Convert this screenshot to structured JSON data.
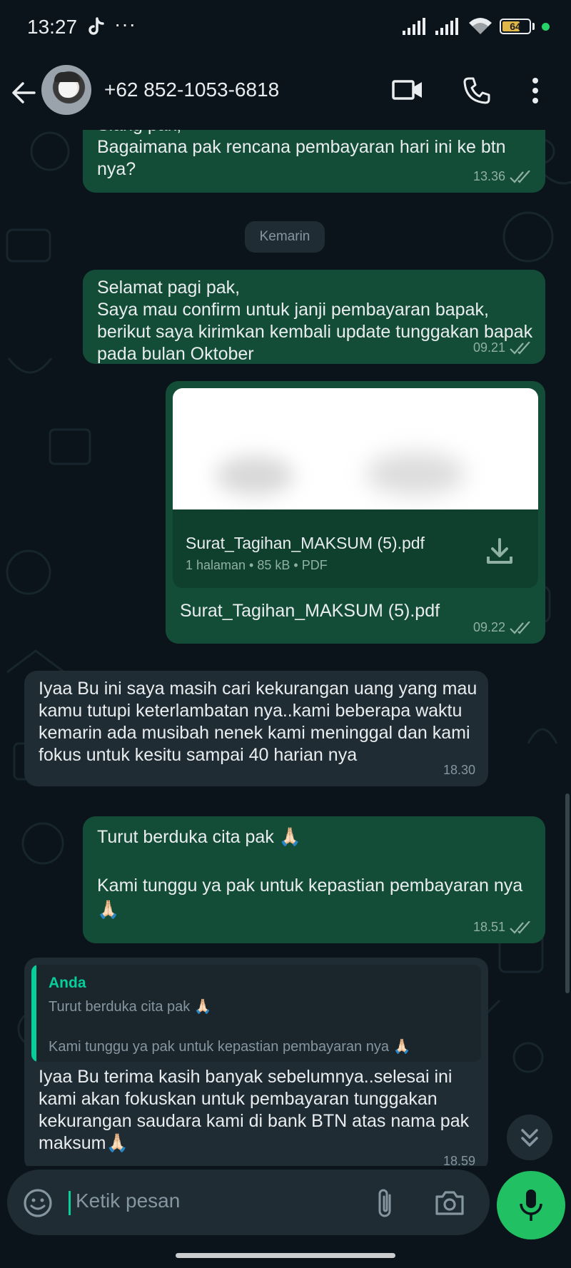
{
  "status_bar": {
    "time": "13:27",
    "more": "···",
    "battery": "64",
    "icons": [
      "tiktok-icon",
      "signal-icon",
      "signal-icon",
      "wifi-icon",
      "battery-icon"
    ]
  },
  "header": {
    "contact_name": "+62 852-1053-6818",
    "icons": [
      "back-arrow-icon",
      "video-call-icon",
      "phone-icon",
      "more-vert-icon"
    ]
  },
  "date_divider": "Kemarin",
  "messages": [
    {
      "direction": "out",
      "text": "Siang pak,\nBagaimana pak rencana pembayaran hari ini ke btn nya?",
      "time": "13.36",
      "status": "read"
    },
    {
      "direction": "out",
      "text": "Selamat pagi pak,\nSaya mau confirm untuk janji pembayaran bapak, berikut saya kirimkan kembali update tunggakan bapak pada bulan Oktober",
      "time": "09.21",
      "status": "read"
    },
    {
      "direction": "out",
      "type": "document",
      "doc_name": "Surat_Tagihan_MAKSUM (5).pdf",
      "doc_meta": "1 halaman • 85 kB • PDF",
      "caption": "Surat_Tagihan_MAKSUM (5).pdf",
      "time": "09.22",
      "status": "read"
    },
    {
      "direction": "in",
      "text": "Iyaa Bu ini saya masih cari kekurangan uang yang mau kamu tutupi keterlambatan nya..kami beberapa waktu kemarin ada musibah nenek kami meninggal dan kami fokus untuk kesitu sampai 40 harian nya",
      "time": "18.30"
    },
    {
      "direction": "out",
      "text": "Turut berduka cita pak 🙏🏻\n\nKami tunggu ya pak untuk kepastian pembayaran nya 🙏🏻",
      "time": "18.51",
      "status": "read"
    },
    {
      "direction": "in",
      "quote": {
        "author": "Anda",
        "line1": "Turut berduka cita pak 🙏🏻",
        "line2": "Kami tunggu ya pak untuk kepastian pembayaran nya 🙏🏻"
      },
      "text": "Iyaa Bu terima kasih banyak sebelumnya..selesai ini kami akan fokuskan untuk pembayaran tunggakan kekurangan saudara kami di bank BTN atas nama pak maksum🙏🏻",
      "time": "18.59"
    }
  ],
  "composer": {
    "placeholder": "Ketik pesan",
    "icons": [
      "emoji-icon",
      "attach-icon",
      "camera-icon",
      "mic-icon"
    ]
  },
  "colors": {
    "outgoing_bubble": "#144d37",
    "incoming_bubble": "#1f2c34",
    "background": "#0b141a",
    "accent": "#21c063"
  }
}
